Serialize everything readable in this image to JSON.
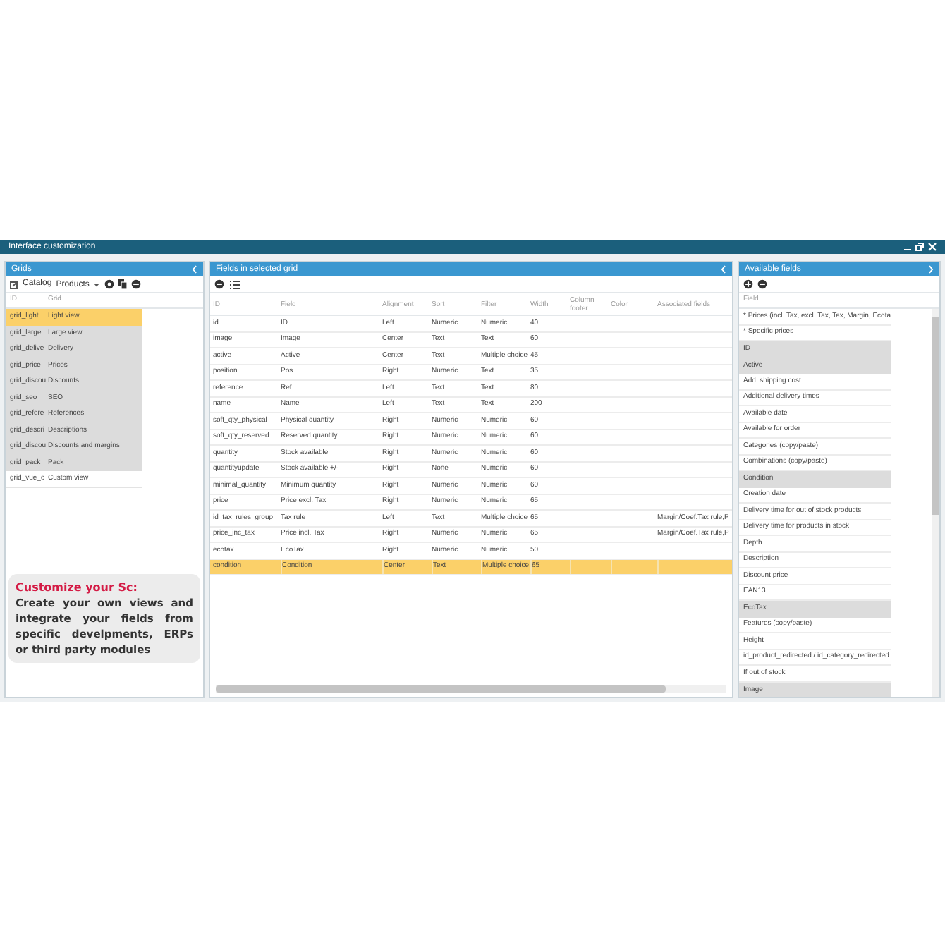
{
  "window": {
    "title": "Interface customization"
  },
  "grids_panel": {
    "title": "Grids",
    "category_label": "Catalog",
    "category_value": "Products",
    "columns": [
      "ID",
      "Grid"
    ],
    "rows": [
      {
        "id": "grid_light",
        "name": "Light view",
        "in_use": true,
        "selected": true
      },
      {
        "id": "grid_large",
        "name": "Large view",
        "in_use": true,
        "selected": false
      },
      {
        "id": "grid_delive",
        "name": "Delivery",
        "in_use": true,
        "selected": false
      },
      {
        "id": "grid_price",
        "name": "Prices",
        "in_use": true,
        "selected": false
      },
      {
        "id": "grid_discou",
        "name": "Discounts",
        "in_use": true,
        "selected": false
      },
      {
        "id": "grid_seo",
        "name": "SEO",
        "in_use": true,
        "selected": false
      },
      {
        "id": "grid_refere",
        "name": "References",
        "in_use": true,
        "selected": false
      },
      {
        "id": "grid_descri",
        "name": "Descriptions",
        "in_use": true,
        "selected": false
      },
      {
        "id": "grid_discou",
        "name": "Discounts and margins",
        "in_use": true,
        "selected": false
      },
      {
        "id": "grid_pack",
        "name": "Pack",
        "in_use": true,
        "selected": false
      },
      {
        "id": "grid_vue_c",
        "name": "Custom view",
        "in_use": false,
        "selected": false
      }
    ]
  },
  "callout": {
    "title": "Customize your Sc:",
    "text": "Create your own views and integrate your fields from specific develpments, ERPs or third party modules"
  },
  "fields_panel": {
    "title": "Fields in selected grid",
    "columns": [
      "ID",
      "Field",
      "Alignment",
      "Sort",
      "Filter",
      "Width",
      "Column footer",
      "Color",
      "Associated fields"
    ],
    "rows": [
      {
        "cells": [
          "id",
          "ID",
          "Left",
          "Numeric",
          "Numeric",
          "40",
          "",
          "",
          ""
        ],
        "selected": false
      },
      {
        "cells": [
          "image",
          "Image",
          "Center",
          "Text",
          "Text",
          "60",
          "",
          "",
          ""
        ],
        "selected": false
      },
      {
        "cells": [
          "active",
          "Active",
          "Center",
          "Text",
          "Multiple choice",
          "45",
          "",
          "",
          ""
        ],
        "selected": false
      },
      {
        "cells": [
          "position",
          "Pos",
          "Right",
          "Numeric",
          "Text",
          "35",
          "",
          "",
          ""
        ],
        "selected": false
      },
      {
        "cells": [
          "reference",
          "Ref",
          "Left",
          "Text",
          "Text",
          "80",
          "",
          "",
          ""
        ],
        "selected": false
      },
      {
        "cells": [
          "name",
          "Name",
          "Left",
          "Text",
          "Text",
          "200",
          "",
          "",
          ""
        ],
        "selected": false
      },
      {
        "cells": [
          "soft_qty_physical",
          "Physical quantity",
          "Right",
          "Numeric",
          "Numeric",
          "60",
          "",
          "",
          ""
        ],
        "selected": false
      },
      {
        "cells": [
          "soft_qty_reserved",
          "Reserved quantity",
          "Right",
          "Numeric",
          "Numeric",
          "60",
          "",
          "",
          ""
        ],
        "selected": false
      },
      {
        "cells": [
          "quantity",
          "Stock available",
          "Right",
          "Numeric",
          "Numeric",
          "60",
          "",
          "",
          ""
        ],
        "selected": false
      },
      {
        "cells": [
          "quantityupdate",
          "Stock available +/-",
          "Right",
          "None",
          "Numeric",
          "60",
          "",
          "",
          ""
        ],
        "selected": false
      },
      {
        "cells": [
          "minimal_quantity",
          "Minimum quantity",
          "Right",
          "Numeric",
          "Numeric",
          "60",
          "",
          "",
          ""
        ],
        "selected": false
      },
      {
        "cells": [
          "price",
          "Price excl. Tax",
          "Right",
          "Numeric",
          "Numeric",
          "65",
          "",
          "",
          ""
        ],
        "selected": false
      },
      {
        "cells": [
          "id_tax_rules_group",
          "Tax rule",
          "Left",
          "Text",
          "Multiple choice",
          "65",
          "",
          "",
          "Margin/Coef.Tax rule,P"
        ],
        "selected": false
      },
      {
        "cells": [
          "price_inc_tax",
          "Price incl. Tax",
          "Right",
          "Numeric",
          "Numeric",
          "65",
          "",
          "",
          "Margin/Coef.Tax rule,P"
        ],
        "selected": false
      },
      {
        "cells": [
          "ecotax",
          "EcoTax",
          "Right",
          "Numeric",
          "Numeric",
          "50",
          "",
          "",
          ""
        ],
        "selected": false
      },
      {
        "cells": [
          "condition",
          "Condition",
          "Center",
          "Text",
          "Multiple choice",
          "65",
          "",
          "",
          ""
        ],
        "selected": true
      }
    ]
  },
  "available_panel": {
    "title": "Available fields",
    "column": "Field",
    "items": [
      {
        "label": "* Prices (incl. Tax, excl. Tax, Tax, Margin, Ecota",
        "in_grid": false
      },
      {
        "label": "* Specific prices",
        "in_grid": false
      },
      {
        "label": "ID",
        "in_grid": true
      },
      {
        "label": "Active",
        "in_grid": true
      },
      {
        "label": "Add. shipping cost",
        "in_grid": false
      },
      {
        "label": "Additional delivery times",
        "in_grid": false
      },
      {
        "label": "Available date",
        "in_grid": false
      },
      {
        "label": "Available for order",
        "in_grid": false
      },
      {
        "label": "Categories (copy/paste)",
        "in_grid": false
      },
      {
        "label": "Combinations (copy/paste)",
        "in_grid": false
      },
      {
        "label": "Condition",
        "in_grid": true
      },
      {
        "label": "Creation date",
        "in_grid": false
      },
      {
        "label": "Delivery time for out of stock products",
        "in_grid": false
      },
      {
        "label": "Delivery time for products in stock",
        "in_grid": false
      },
      {
        "label": "Depth",
        "in_grid": false
      },
      {
        "label": "Description",
        "in_grid": false
      },
      {
        "label": "Discount price",
        "in_grid": false
      },
      {
        "label": "EAN13",
        "in_grid": false
      },
      {
        "label": "EcoTax",
        "in_grid": true
      },
      {
        "label": "Features (copy/paste)",
        "in_grid": false
      },
      {
        "label": "Height",
        "in_grid": false
      },
      {
        "label": "id_product_redirected / id_category_redirected",
        "in_grid": false
      },
      {
        "label": "If out of stock",
        "in_grid": false
      },
      {
        "label": "Image",
        "in_grid": true
      }
    ]
  }
}
